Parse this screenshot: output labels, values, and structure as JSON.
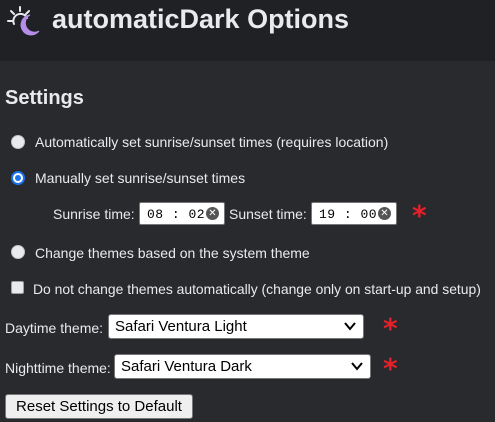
{
  "app": {
    "title": "automaticDark Options",
    "logo_icon": "sun-moon-logo-icon"
  },
  "settings": {
    "title": "Settings",
    "options": [
      {
        "label": "Automatically set sunrise/sunset times (requires location)",
        "checked": false
      },
      {
        "label": "Manually set sunrise/sunset times",
        "checked": true
      },
      {
        "label": "Change themes based on the system theme",
        "checked": false
      }
    ],
    "sunrise": {
      "label": "Sunrise time:",
      "value": "08 : 02"
    },
    "sunset": {
      "label": "Sunset time:",
      "value": "19 : 00"
    },
    "no_auto_change": {
      "label": "Do not change themes automatically (change only on start-up and setup)",
      "checked": false
    },
    "daytime": {
      "label": "Daytime theme:",
      "value": "Safari Ventura Light"
    },
    "nighttime": {
      "label": "Nighttime theme:",
      "value": "Safari Ventura Dark"
    },
    "required_marker": "*",
    "reset_label": "Reset Settings to Default"
  },
  "colors": {
    "accent": "#1a73e8",
    "required": "#e5202a",
    "header_bg": "#202124",
    "page_bg": "#292a2d"
  }
}
